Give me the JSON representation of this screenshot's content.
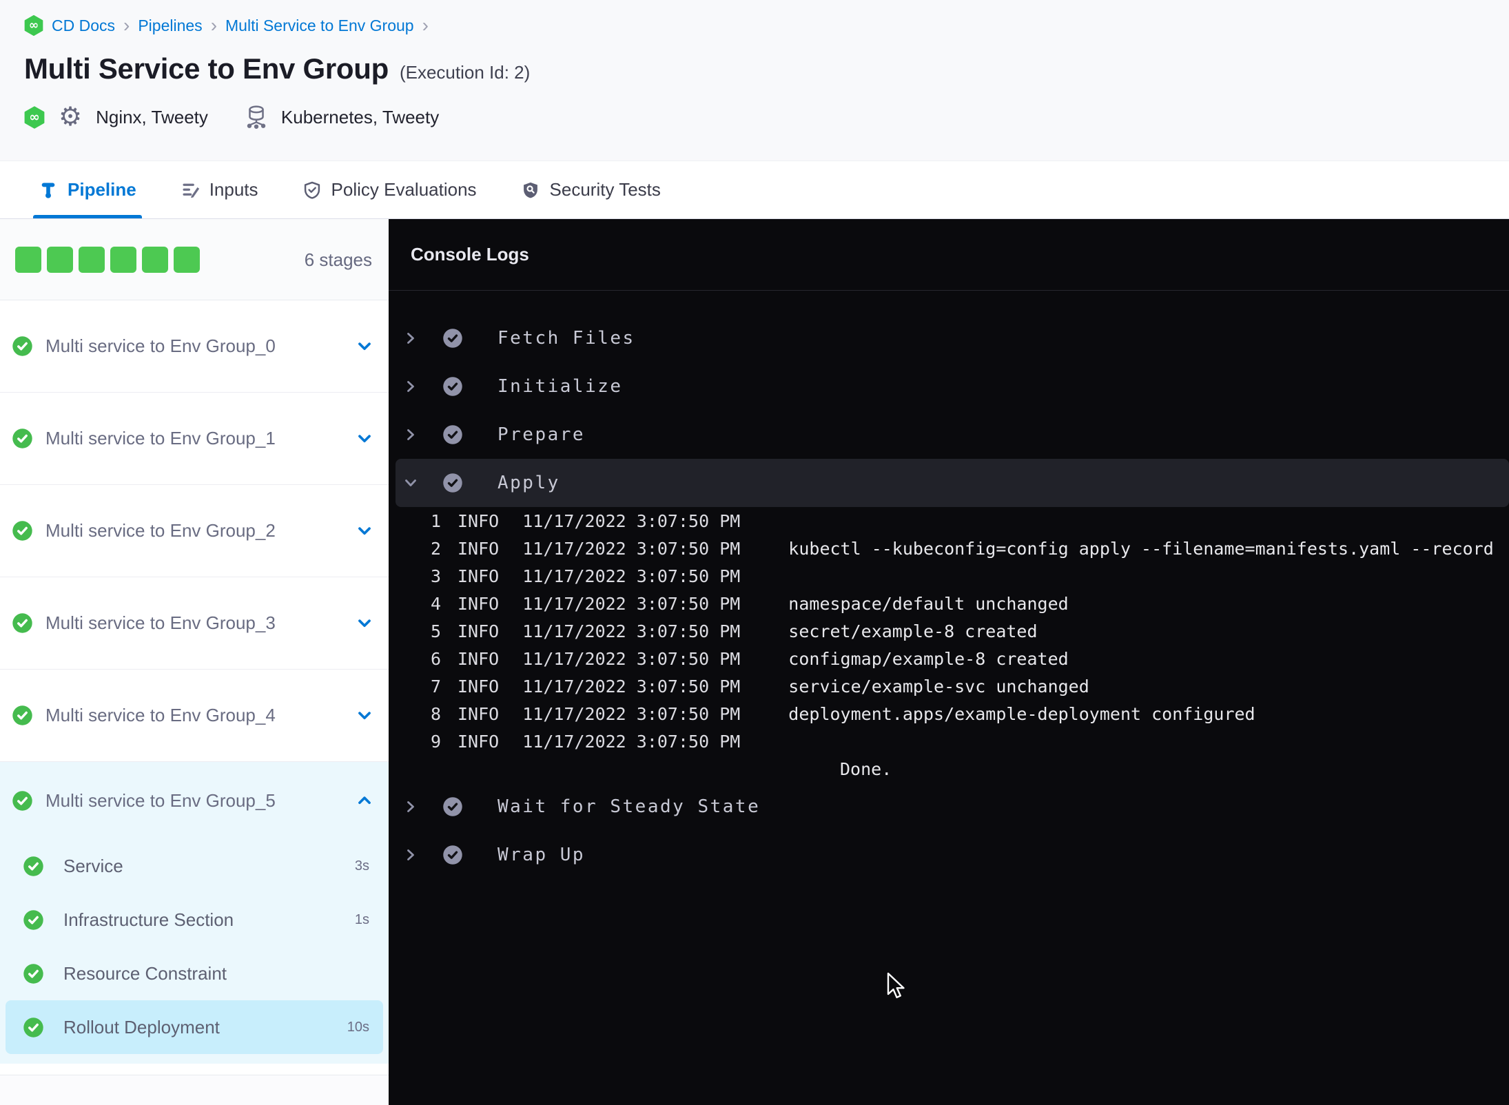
{
  "colors": {
    "accent_blue": "#0278d5",
    "success_green": "#4dc952",
    "console_bg": "#0a0a0d",
    "expanded_stage_bg": "#ebf8fd",
    "selected_step_bg": "#c8eefc"
  },
  "breadcrumb": {
    "items": [
      "CD Docs",
      "Pipelines",
      "Multi Service to Env Group"
    ],
    "separator": "›"
  },
  "header": {
    "title": "Multi Service to Env Group",
    "execution_id": "(Execution Id: 2)",
    "services_label": "Nginx, Tweety",
    "environments_label": "Kubernetes, Tweety"
  },
  "tabs": [
    {
      "label": "Pipeline",
      "icon": "pipeline-icon",
      "active": true
    },
    {
      "label": "Inputs",
      "icon": "inputs-icon",
      "active": false
    },
    {
      "label": "Policy Evaluations",
      "icon": "policy-evaluations-icon",
      "active": false
    },
    {
      "label": "Security Tests",
      "icon": "security-tests-icon",
      "active": false
    }
  ],
  "stages_panel": {
    "stage_count": 6,
    "count_label": "6 stages",
    "stages": [
      {
        "name": "Multi service to Env Group_0",
        "status": "success",
        "expanded": false
      },
      {
        "name": "Multi service to Env Group_1",
        "status": "success",
        "expanded": false
      },
      {
        "name": "Multi service to Env Group_2",
        "status": "success",
        "expanded": false
      },
      {
        "name": "Multi service to Env Group_3",
        "status": "success",
        "expanded": false
      },
      {
        "name": "Multi service to Env Group_4",
        "status": "success",
        "expanded": false
      },
      {
        "name": "Multi service to Env Group_5",
        "status": "success",
        "expanded": true,
        "steps": [
          {
            "name": "Service",
            "duration": "3s",
            "status": "success",
            "selected": false
          },
          {
            "name": "Infrastructure Section",
            "duration": "1s",
            "status": "success",
            "selected": false
          },
          {
            "name": "Resource Constraint",
            "duration": "",
            "status": "success",
            "selected": false
          },
          {
            "name": "Rollout Deployment",
            "duration": "10s",
            "status": "success",
            "selected": true
          }
        ]
      }
    ]
  },
  "console": {
    "title": "Console Logs",
    "steps": [
      {
        "name": "Fetch Files",
        "status": "success",
        "expanded": false
      },
      {
        "name": "Initialize",
        "status": "success",
        "expanded": false
      },
      {
        "name": "Prepare",
        "status": "success",
        "expanded": false
      },
      {
        "name": "Apply",
        "status": "success",
        "expanded": true,
        "logs": [
          {
            "line": "1",
            "level": "INFO",
            "time": "11/17/2022 3:07:50 PM",
            "message": ""
          },
          {
            "line": "2",
            "level": "INFO",
            "time": "11/17/2022 3:07:50 PM",
            "message": "kubectl --kubeconfig=config apply --filename=manifests.yaml --record"
          },
          {
            "line": "3",
            "level": "INFO",
            "time": "11/17/2022 3:07:50 PM",
            "message": ""
          },
          {
            "line": "4",
            "level": "INFO",
            "time": "11/17/2022 3:07:50 PM",
            "message": "namespace/default unchanged"
          },
          {
            "line": "5",
            "level": "INFO",
            "time": "11/17/2022 3:07:50 PM",
            "message": "secret/example-8 created"
          },
          {
            "line": "6",
            "level": "INFO",
            "time": "11/17/2022 3:07:50 PM",
            "message": "configmap/example-8 created"
          },
          {
            "line": "7",
            "level": "INFO",
            "time": "11/17/2022 3:07:50 PM",
            "message": "service/example-svc unchanged"
          },
          {
            "line": "8",
            "level": "INFO",
            "time": "11/17/2022 3:07:50 PM",
            "message": "deployment.apps/example-deployment configured"
          },
          {
            "line": "9",
            "level": "INFO",
            "time": "11/17/2022 3:07:50 PM",
            "message": ""
          }
        ],
        "tail_message": "Done."
      },
      {
        "name": "Wait for Steady State",
        "status": "success",
        "expanded": false
      },
      {
        "name": "Wrap Up",
        "status": "success",
        "expanded": false
      }
    ]
  }
}
